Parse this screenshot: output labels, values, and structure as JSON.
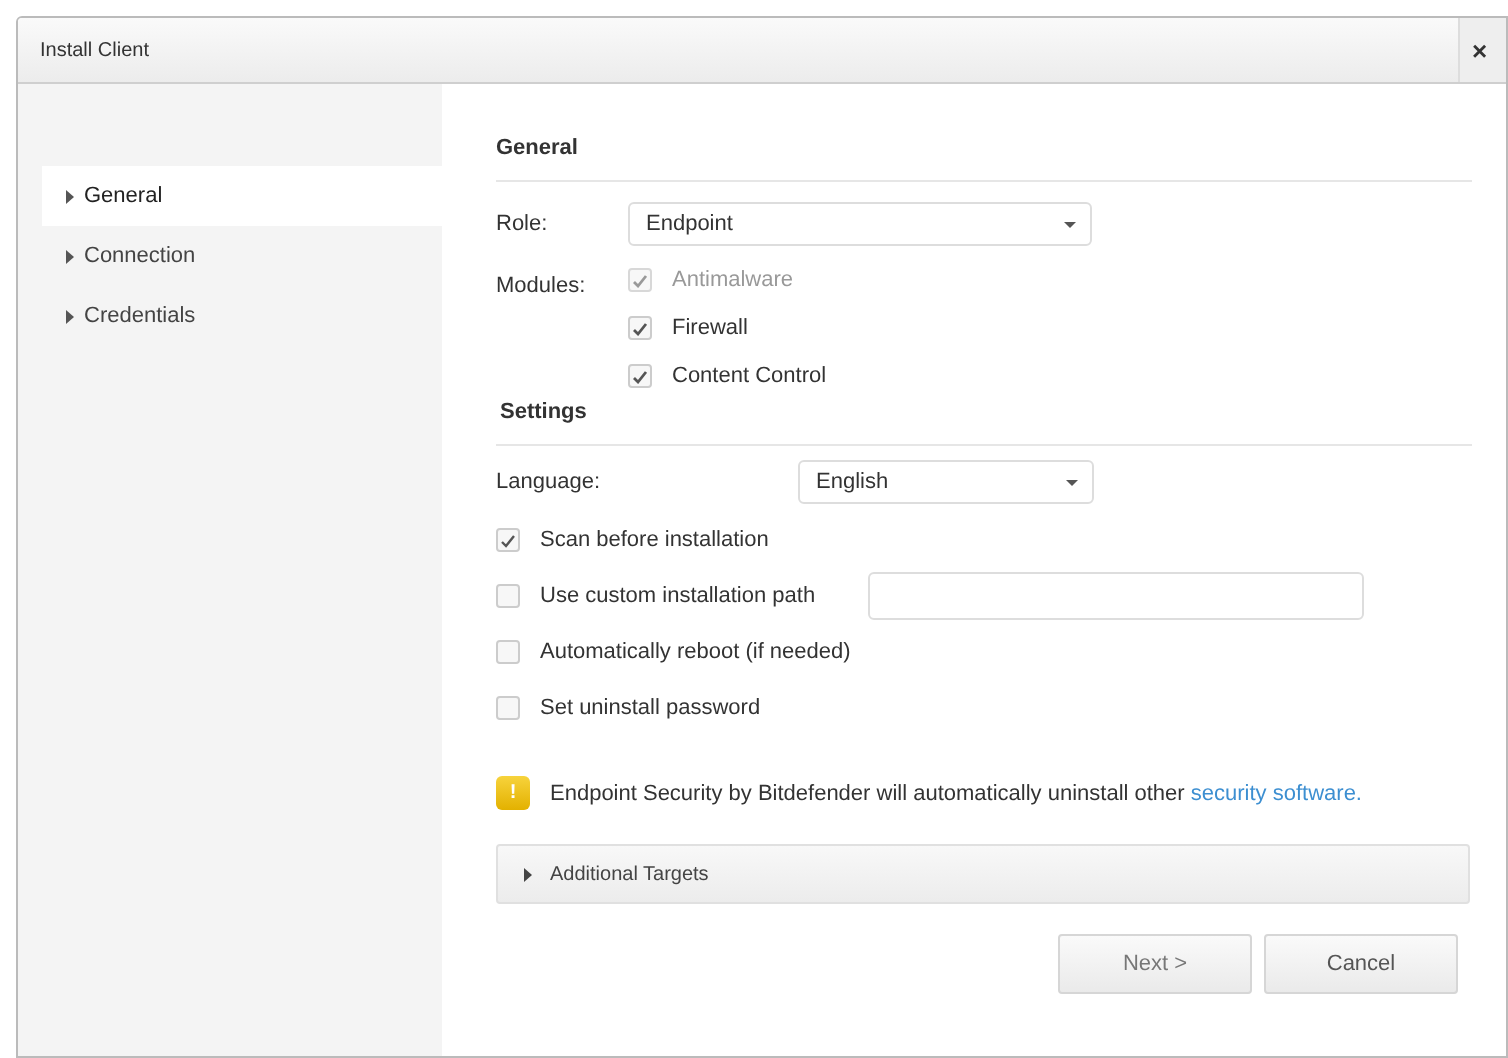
{
  "window": {
    "title": "Install Client",
    "close": "×"
  },
  "sidebar": {
    "items": [
      {
        "label": "General",
        "selected": true
      },
      {
        "label": "Connection",
        "selected": false
      },
      {
        "label": "Credentials",
        "selected": false
      }
    ]
  },
  "general": {
    "heading": "General",
    "role": {
      "label": "Role:",
      "value": "Endpoint"
    },
    "modules": {
      "label": "Modules:",
      "items": [
        {
          "label": "Antimalware",
          "checked": true,
          "disabled": true
        },
        {
          "label": "Firewall",
          "checked": true,
          "disabled": false
        },
        {
          "label": "Content Control",
          "checked": true,
          "disabled": false
        }
      ]
    }
  },
  "settings": {
    "heading": "Settings",
    "language": {
      "label": "Language:",
      "value": "English"
    },
    "options": [
      {
        "label": "Scan before installation",
        "checked": true,
        "kind": "checkbox"
      },
      {
        "label": "Use custom installation path",
        "checked": false,
        "kind": "path"
      },
      {
        "label": "Automatically reboot (if needed)",
        "checked": false,
        "kind": "checkbox"
      },
      {
        "label": "Set uninstall password",
        "checked": false,
        "kind": "checkbox"
      }
    ]
  },
  "warning": {
    "icon": "!",
    "text": "Endpoint Security by Bitdefender will automatically uninstall other ",
    "link": "security software."
  },
  "additional_targets": {
    "label": "Additional Targets",
    "expanded": false
  },
  "buttons": [
    "Next >",
    "Cancel"
  ]
}
